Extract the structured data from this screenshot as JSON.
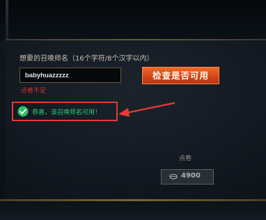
{
  "form": {
    "prompt": "想要的召唤师名（16个字符/8个汉字以内）",
    "name_value": "babyhuazzzzz",
    "error_text": "点卷不足",
    "check_button_label": "检查是否可用"
  },
  "result": {
    "success_text": "恭喜，该召唤师名可用！",
    "status_icon": "check-circle-icon",
    "highlight_color": "#e53a35",
    "success_color": "#2fce73"
  },
  "purchase": {
    "price_label": "点卷",
    "price_value": "4900",
    "currency_icon": "coin-icon",
    "button_state": "disabled"
  },
  "colors": {
    "accent_button": "#d4471a",
    "error": "#e0352b",
    "gold_rule": "#7a6538"
  }
}
